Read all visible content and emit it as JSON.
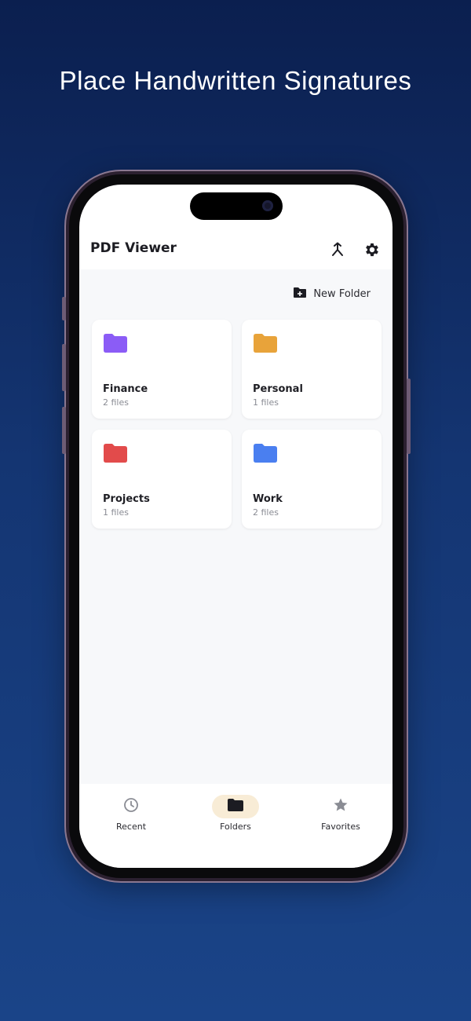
{
  "headline": "Place Handwritten Signatures",
  "app": {
    "title": "PDF Viewer",
    "merge_icon": "merge-icon",
    "settings_icon": "gear-icon"
  },
  "toolbar": {
    "new_folder_label": "New Folder",
    "new_folder_icon": "folder-plus-icon"
  },
  "folders": [
    {
      "name": "Finance",
      "count": "2 files",
      "color": "#8b5cf6"
    },
    {
      "name": "Personal",
      "count": "1 files",
      "color": "#e8a33a"
    },
    {
      "name": "Projects",
      "count": "1 files",
      "color": "#e24b4b"
    },
    {
      "name": "Work",
      "count": "2 files",
      "color": "#4a7ff0"
    }
  ],
  "fab": {
    "icon": "plus-icon",
    "color": "#e3a93f"
  },
  "nav": {
    "items": [
      {
        "label": "Recent",
        "icon": "clock-icon",
        "active": false
      },
      {
        "label": "Folders",
        "icon": "folder-icon",
        "active": true
      },
      {
        "label": "Favorites",
        "icon": "star-icon",
        "active": false
      }
    ]
  },
  "colors": {
    "background_top": "#0b1f4f",
    "background_bottom": "#1a4488",
    "nav_active_pill": "#f8ecd6"
  }
}
